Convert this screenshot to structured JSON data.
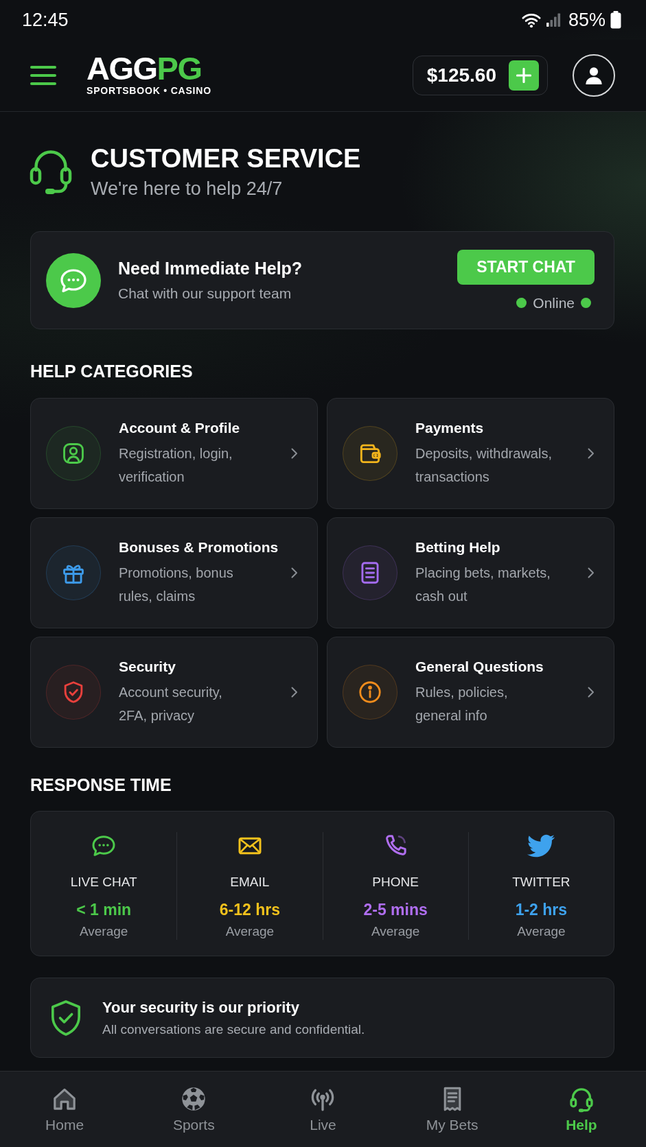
{
  "status_bar": {
    "time": "12:45",
    "battery": "85%"
  },
  "header": {
    "logo": {
      "text": "AGG",
      "accent_text": "PG",
      "tagline": "SPORTSBOOK • CASINO"
    },
    "balance": "$125.60"
  },
  "hero": {
    "title": "CUSTOMER SERVICE",
    "subtitle": "We're here to help 24/7"
  },
  "chat_card": {
    "title": "Need Immediate Help?",
    "subtitle": "Chat with our support team",
    "button": "START CHAT",
    "status": "Online",
    "online": true
  },
  "help_categories": {
    "title": "HELP CATEGORIES",
    "items": [
      {
        "title": "Account & Profile",
        "description": [
          "Registration, login,",
          "verification"
        ],
        "color": "#4cc94a"
      },
      {
        "title": "Payments",
        "description": [
          "Deposits, withdrawals,",
          "transactions"
        ],
        "color": "#f2b41c"
      },
      {
        "title": "Bonuses & Promotions",
        "description": [
          "Promotions, bonus",
          "rules, claims"
        ],
        "color": "#3d9bea"
      },
      {
        "title": "Betting Help",
        "description": [
          "Placing bets, markets,",
          "cash out"
        ],
        "color": "#a46cf0"
      },
      {
        "title": "Security",
        "description": [
          "Account security,",
          "2FA, privacy"
        ],
        "color": "#e8403c"
      },
      {
        "title": "General Questions",
        "description": [
          "Rules, policies,",
          "general info"
        ],
        "color": "#f08c1c"
      }
    ]
  },
  "response_time": {
    "title": "RESPONSE TIME",
    "channels": [
      {
        "name": "LIVE CHAT",
        "time": "< 1 min",
        "note": "Average",
        "color": "#4cc94a"
      },
      {
        "name": "EMAIL",
        "time": "6-12 hrs",
        "note": "Average",
        "color": "#f2c11c"
      },
      {
        "name": "PHONE",
        "time": "2-5 mins",
        "note": "Average",
        "color": "#b06ef0"
      },
      {
        "name": "TWITTER",
        "time": "1-2 hrs",
        "note": "Average",
        "color": "#3ea2ee"
      }
    ]
  },
  "security_note": {
    "title": "Your security is our priority",
    "text": "All conversations are secure and confidential."
  },
  "bottom_nav": {
    "items": [
      {
        "label": "Home",
        "selected": false
      },
      {
        "label": "Sports",
        "selected": false
      },
      {
        "label": "Live",
        "selected": false
      },
      {
        "label": "My Bets",
        "selected": false
      },
      {
        "label": "Help",
        "selected": true
      }
    ]
  }
}
